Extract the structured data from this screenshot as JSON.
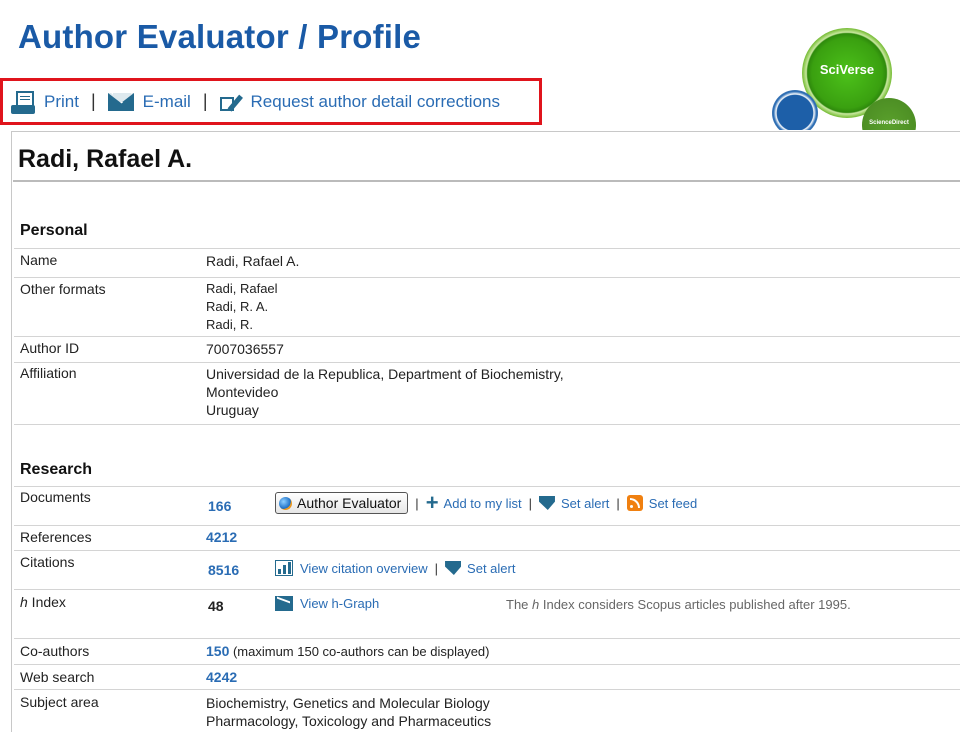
{
  "slide": {
    "title": "Author Evaluator / Profile"
  },
  "logo": {
    "main_text": "SciVerse",
    "sub_text": "ScienceDirect"
  },
  "toolbar": {
    "print_label": "Print",
    "email_label": "E-mail",
    "corrections_label": "Request author detail corrections",
    "separator": "|"
  },
  "author": {
    "name": "Radi, Rafael A."
  },
  "personal": {
    "heading": "Personal",
    "name_label": "Name",
    "name_value": "Radi, Rafael A.",
    "other_formats_label": "Other formats",
    "other_formats": [
      "Radi, Rafael",
      "Radi, R. A.",
      "Radi, R."
    ],
    "author_id_label": "Author ID",
    "author_id_value": "7007036557",
    "affiliation_label": "Affiliation",
    "affiliation_lines": [
      "Universidad de la Republica, Department of Biochemistry,",
      "Montevideo",
      "Uruguay"
    ]
  },
  "research": {
    "heading": "Research",
    "documents_label": "Documents",
    "documents_value": "166",
    "author_evaluator_button": "Author Evaluator",
    "add_to_list": "Add to my list",
    "set_alert": "Set alert",
    "set_feed": "Set feed",
    "references_label": "References",
    "references_value": "4212",
    "citations_label": "Citations",
    "citations_value": "8516",
    "view_citation_overview": "View citation overview",
    "h_index_label_italic": "h",
    "h_index_label_rest": " Index",
    "h_index_value": "48",
    "view_h_graph": "View h-Graph",
    "h_note_pre": "The ",
    "h_note_italic": "h",
    "h_note_post": " Index considers Scopus articles published after 1995.",
    "coauthors_label": "Co-authors",
    "coauthors_value": "150",
    "coauthors_note": " (maximum 150 co-authors can be displayed)",
    "web_search_label": "Web search",
    "web_search_value": "4242",
    "subject_area_label": "Subject area",
    "subject_areas": [
      "Biochemistry, Genetics and Molecular Biology",
      "Pharmacology, Toxicology and Pharmaceutics"
    ]
  },
  "colors": {
    "title_blue": "#1a5aa6",
    "link_blue": "#2a6cb4",
    "highlight_red": "#e0141c",
    "brand_green": "#3aa010"
  },
  "icons": [
    "print-icon",
    "email-icon",
    "edit-icon",
    "globe-icon",
    "plus-icon",
    "alert-tag-icon",
    "rss-icon",
    "bar-chart-icon",
    "h-graph-icon"
  ]
}
